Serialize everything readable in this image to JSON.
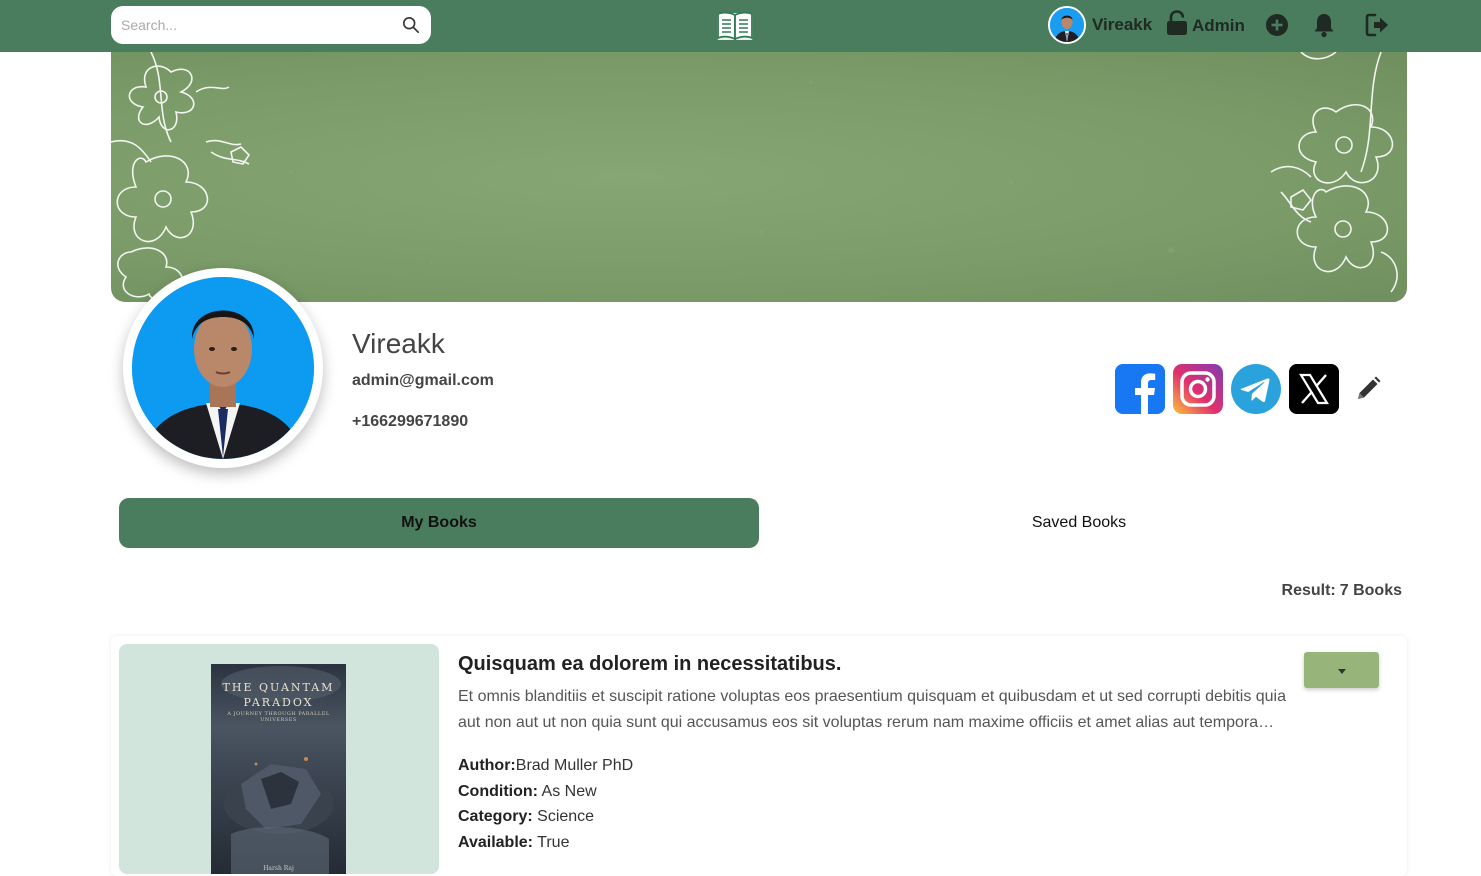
{
  "navbar": {
    "search_placeholder": "Search...",
    "user_name": "Vireakk",
    "role_label": "Admin",
    "icons": [
      "search-icon",
      "book-logo-icon",
      "lock-open-icon",
      "add-circle-icon",
      "bell-icon",
      "logout-icon"
    ]
  },
  "profile": {
    "name": "Vireakk",
    "email": "admin@gmail.com",
    "phone": "+166299671890",
    "socials": [
      "facebook-icon",
      "instagram-icon",
      "telegram-icon",
      "x-icon"
    ]
  },
  "tabs": {
    "my_books": "My Books",
    "saved_books": "Saved Books",
    "active": "my_books"
  },
  "results": {
    "label": "Result:",
    "count_text": "7 Books"
  },
  "book": {
    "title": "Quisquam ea dolorem in necessitatibus.",
    "description": "Et omnis blanditiis et suscipit ratione voluptas eos praesentium quisquam et quibusdam et ut sed corrupti debitis quia aut non aut ut non quia sunt qui accusamus eos sit voluptas rerum nam maxime officiis et amet alias aut tempora…",
    "author_label": "Author:",
    "author": "Brad Muller PhD",
    "condition_label": "Condition:",
    "condition": "As New",
    "category_label": "Category:",
    "category": "Science",
    "available_label": "Available:",
    "available": "True",
    "cover": {
      "title": "THE QUANTAM PARADOX",
      "subtitle": "A JOURNEY THROUGH PARALLEL UNIVERSES",
      "author": "Harsh Raj"
    }
  },
  "colors": {
    "navbar": "#4a7c5e",
    "tab_active": "#4a7c5e",
    "banner": "#7b9b69",
    "cover_bg": "#d1e5dc",
    "dropdown": "#97b57a"
  }
}
